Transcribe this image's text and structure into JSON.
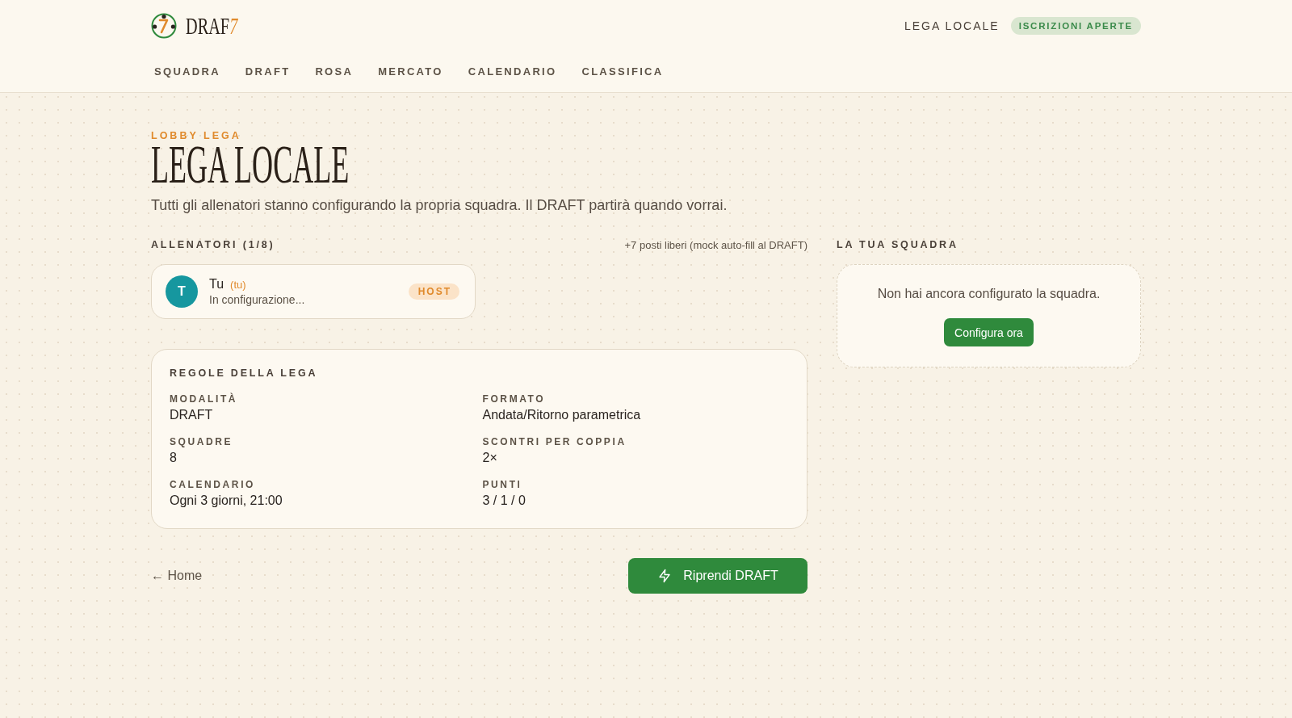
{
  "header": {
    "logo": {
      "wordmark": "DRAF",
      "accent": "7"
    },
    "league_name": "LEGA LOCALE",
    "status_badge": "ISCRIZIONI APERTE"
  },
  "nav": [
    {
      "label": "SQUADRA",
      "selected": false
    },
    {
      "label": "DRAFT",
      "selected": false
    },
    {
      "label": "ROSA",
      "selected": false
    },
    {
      "label": "MERCATO",
      "selected": false
    },
    {
      "label": "CALENDARIO",
      "selected": false
    },
    {
      "label": "CLASSIFICA",
      "selected": false
    }
  ],
  "page": {
    "eyebrow": "LOBBY LEGA",
    "title": "LEGA LOCALE",
    "subtitle": "Tutti gli allenatori stanno configurando la propria squadra. Il DRAFT partirà quando vorrai."
  },
  "coaches_section": {
    "heading": "ALLENATORI (1/8)",
    "note": "+7 posti liberi (mock auto-fill al DRAFT)",
    "coaches": [
      {
        "initial": "T",
        "name": "Tu",
        "you_tag": "(tu)",
        "status": "In configurazione...",
        "badge": "HOST",
        "color": "#16979f"
      }
    ]
  },
  "rules": {
    "heading": "REGOLE DELLA LEGA",
    "items": [
      {
        "label": "MODALITÀ",
        "value": "DRAFT"
      },
      {
        "label": "FORMATO",
        "value": "Andata/Ritorno parametrica"
      },
      {
        "label": "SQUADRE",
        "value": "8"
      },
      {
        "label": "SCONTRI PER COPPIA",
        "value": "2×"
      },
      {
        "label": "CALENDARIO",
        "value": "Ogni 3 giorni, 21:00"
      },
      {
        "label": "PUNTI",
        "value": "3 / 1 / 0"
      }
    ]
  },
  "actions": {
    "back_link": "← Home",
    "primary_button": "Riprendi DRAFT"
  },
  "my_team": {
    "heading": "LA TUA SQUADRA",
    "message": "Non hai ancora configurato la squadra.",
    "button": "Configura ora"
  }
}
